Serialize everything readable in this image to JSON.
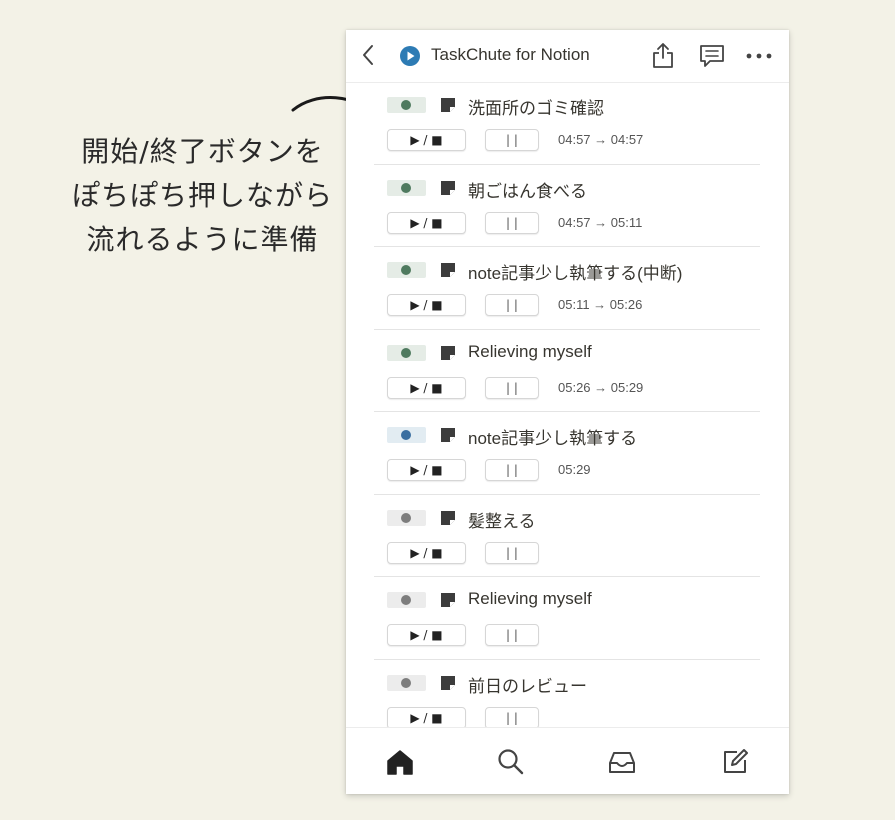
{
  "annotation": {
    "lines": [
      "開始/終了ボタンを",
      "ぽちぽち押しながら",
      "流れるように準備"
    ]
  },
  "app": {
    "title": "TaskChute for Notion",
    "icons": [
      "back-icon",
      "play-logo-icon",
      "share-icon",
      "comment-icon",
      "more-icon"
    ]
  },
  "buttons": {
    "start_stop": "▶ / ■",
    "pause": "| |"
  },
  "colors": {
    "background": "#f3f2e7",
    "done_status": "#4f7a5f",
    "active_status": "#3b6fa0",
    "todo_status": "#7d7d7d",
    "logo": "#2d7bb4"
  },
  "tasks": [
    {
      "name": "洗面所のゴミ確認",
      "status": "done",
      "time": "04:57 → 04:57"
    },
    {
      "name": "朝ごはん食べる",
      "status": "done",
      "time": "04:57 → 05:11"
    },
    {
      "name": "note記事少し執筆する(中断)",
      "status": "done",
      "time": "05:11 → 05:26"
    },
    {
      "name": "Relieving myself",
      "status": "done",
      "time": "05:26 → 05:29"
    },
    {
      "name": "note記事少し執筆する",
      "status": "active",
      "time": "05:29"
    },
    {
      "name": "髪整える",
      "status": "todo",
      "time": ""
    },
    {
      "name": "Relieving myself",
      "status": "todo",
      "time": ""
    },
    {
      "name": "前日のレビュー",
      "status": "todo",
      "time": ""
    }
  ],
  "bottom_nav": [
    "home-icon",
    "search-icon",
    "inbox-icon",
    "new-page-icon"
  ]
}
